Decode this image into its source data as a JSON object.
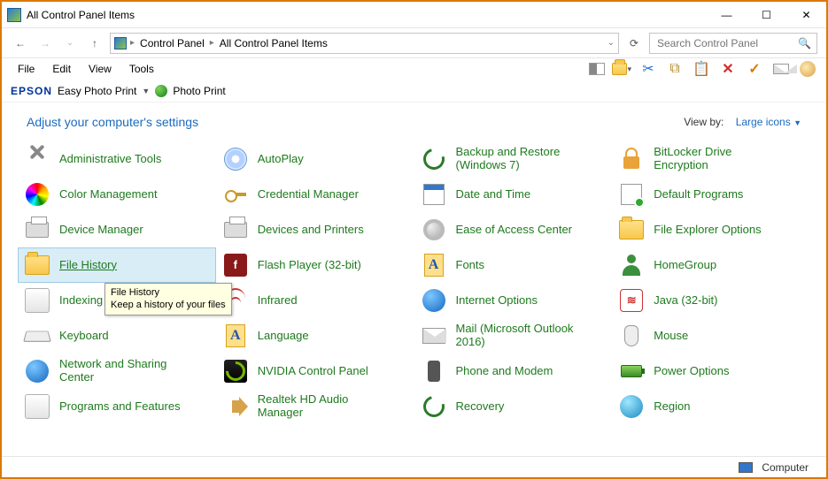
{
  "window": {
    "title": "All Control Panel Items",
    "buttons": {
      "minimize": "—",
      "maximize": "☐",
      "close": "✕"
    }
  },
  "nav": {
    "breadcrumb": [
      "Control Panel",
      "All Control Panel Items"
    ],
    "refresh_dropdown": "⌄"
  },
  "search": {
    "placeholder": "Search Control Panel"
  },
  "menu": {
    "items": [
      "File",
      "Edit",
      "View",
      "Tools"
    ]
  },
  "toolbar_icons": [
    "panel-icon",
    "view-options-icon",
    "scissors-icon",
    "copy-icon",
    "clipboard-icon",
    "delete-icon",
    "check-icon",
    "mail-icon",
    "shell-icon"
  ],
  "epson": {
    "brand": "EPSON",
    "easy": "Easy Photo Print",
    "photo": "Photo Print"
  },
  "header": {
    "heading": "Adjust your computer's settings",
    "viewby_label": "View by:",
    "viewby_value": "Large icons"
  },
  "items": [
    {
      "label": "Administrative Tools",
      "icon": "tools"
    },
    {
      "label": "AutoPlay",
      "icon": "disc"
    },
    {
      "label": "Backup and Restore (Windows 7)",
      "icon": "recover",
      "tall": true
    },
    {
      "label": "BitLocker Drive Encryption",
      "icon": "lock"
    },
    {
      "label": "Color Management",
      "icon": "colorwheel"
    },
    {
      "label": "Credential Manager",
      "icon": "key"
    },
    {
      "label": "Date and Time",
      "icon": "calendar"
    },
    {
      "label": "Default Programs",
      "icon": "defprog"
    },
    {
      "label": "Device Manager",
      "icon": "printer"
    },
    {
      "label": "Devices and Printers",
      "icon": "printer"
    },
    {
      "label": "Ease of Access Center",
      "icon": "gear"
    },
    {
      "label": "File Explorer Options",
      "icon": "folder"
    },
    {
      "label": "File History",
      "icon": "folder",
      "selected": true
    },
    {
      "label": "Flash Player (32-bit)",
      "icon": "flash"
    },
    {
      "label": "Fonts",
      "icon": "fonts"
    },
    {
      "label": "HomeGroup",
      "icon": "people"
    },
    {
      "label": "Indexing Options",
      "icon": "ibox",
      "obscured": true
    },
    {
      "label": "Infrared",
      "icon": "wifi"
    },
    {
      "label": "Internet Options",
      "icon": "globe"
    },
    {
      "label": "Java (32-bit)",
      "icon": "java"
    },
    {
      "label": "Keyboard",
      "icon": "keyb"
    },
    {
      "label": "Language",
      "icon": "fonts"
    },
    {
      "label": "Mail (Microsoft Outlook 2016)",
      "icon": "mail",
      "tall": true
    },
    {
      "label": "Mouse",
      "icon": "mouse"
    },
    {
      "label": "Network and Sharing Center",
      "icon": "globe",
      "tall": true
    },
    {
      "label": "NVIDIA Control Panel",
      "icon": "nvidia"
    },
    {
      "label": "Phone and Modem",
      "icon": "phone"
    },
    {
      "label": "Power Options",
      "icon": "battery"
    },
    {
      "label": "Programs and Features",
      "icon": "ibox"
    },
    {
      "label": "Realtek HD Audio Manager",
      "icon": "speaker"
    },
    {
      "label": "Recovery",
      "icon": "recover"
    },
    {
      "label": "Region",
      "icon": "regiong"
    }
  ],
  "tooltip": {
    "title": "File History",
    "desc": "Keep a history of your files"
  },
  "status": {
    "text": "Computer"
  }
}
